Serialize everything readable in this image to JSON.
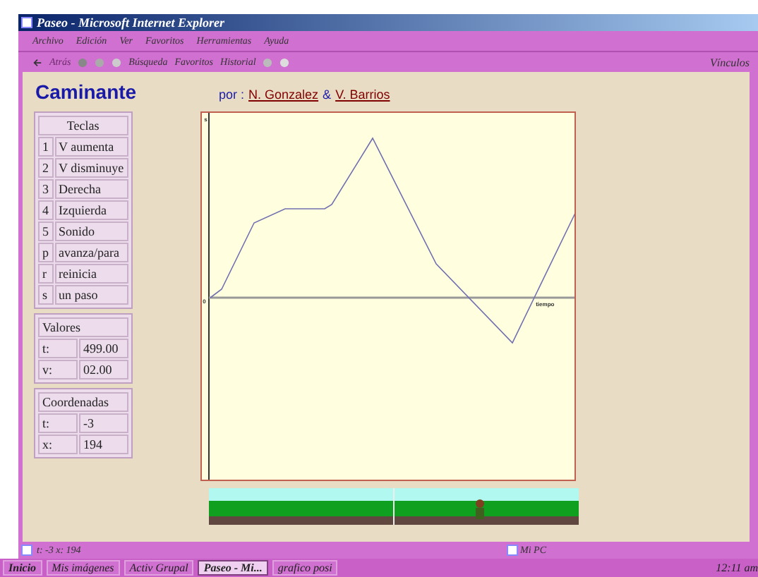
{
  "window": {
    "title": "Paseo - Microsoft Internet Explorer"
  },
  "menu": [
    "Archivo",
    "Edición",
    "Ver",
    "Favoritos",
    "Herramientas",
    "Ayuda"
  ],
  "toolbar": {
    "back": {
      "label": "Atrás",
      "disabled": true
    },
    "search": "Búsqueda",
    "favorites": "Favoritos",
    "history": "Historial",
    "links": "Vínculos"
  },
  "page": {
    "title": "Caminante",
    "byline": "por :",
    "author_1": "N. Gonzalez",
    "separator": "&",
    "author_2": "V. Barrios",
    "keys": {
      "heading": "Teclas",
      "rows": [
        {
          "key": "1",
          "action": "V aumenta"
        },
        {
          "key": "2",
          "action": "V disminuye"
        },
        {
          "key": "3",
          "action": "Derecha"
        },
        {
          "key": "4",
          "action": "Izquierda"
        },
        {
          "key": "5",
          "action": "Sonido"
        },
        {
          "key": "p",
          "action": "avanza/para"
        },
        {
          "key": "r",
          "action": "reinicia"
        },
        {
          "key": "s",
          "action": "un paso"
        }
      ]
    },
    "values": {
      "heading": "Valores",
      "rows": [
        {
          "label": "t:",
          "value": "499.00"
        },
        {
          "label": "v:",
          "value": "02.00"
        }
      ]
    },
    "coords": {
      "heading": "Coordenadas",
      "rows": [
        {
          "label": "t:",
          "value": "-3"
        },
        {
          "label": "x:",
          "value": "194"
        }
      ]
    },
    "graph": {
      "y_label": "s",
      "origin_label": "0",
      "x_label": "tiempo"
    }
  },
  "status_bar": {
    "text": "t: -3  x: 194",
    "zone": "Mi PC"
  },
  "taskbar": {
    "start": "Inicio",
    "items": [
      {
        "label": "Mis imágenes",
        "selected": false
      },
      {
        "label": "Activ Grupal",
        "selected": false
      },
      {
        "label": "Paseo - Mi...",
        "selected": true
      },
      {
        "label": "grafico posi",
        "selected": false
      }
    ],
    "clock": "12:11 am"
  }
}
